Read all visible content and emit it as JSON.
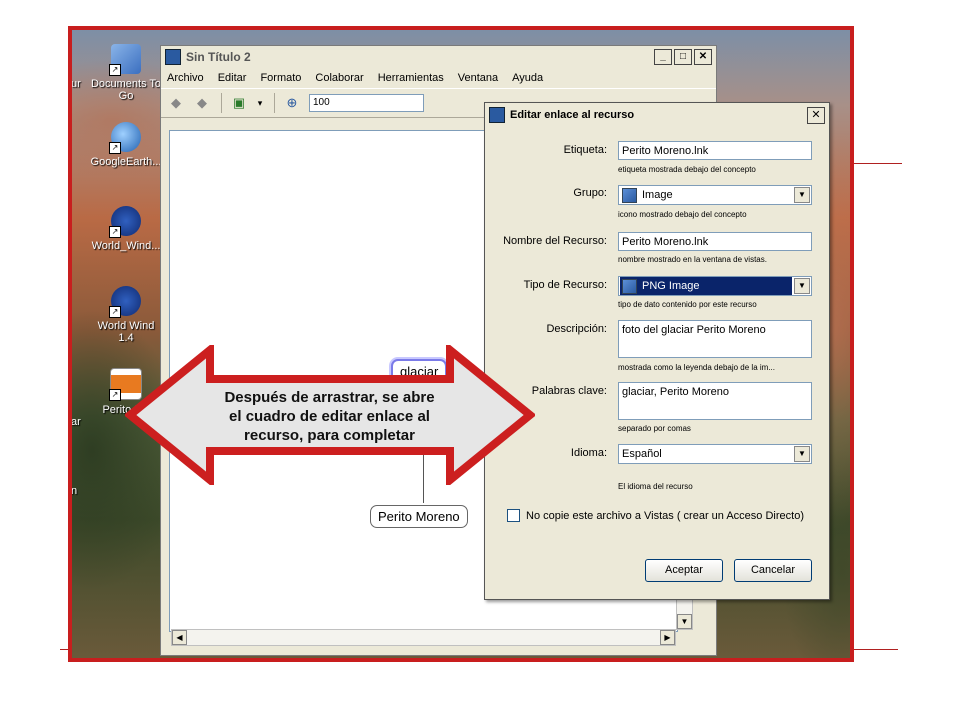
{
  "desktop": {
    "icons": [
      {
        "label": "Documents To Go",
        "icon": "documents-to-go-icon"
      },
      {
        "label": "GoogleEarth...",
        "icon": "google-earth-icon"
      },
      {
        "label": "World_Wind...",
        "icon": "nasa-icon"
      },
      {
        "label": "World Wind 1.4",
        "icon": "nasa-icon"
      },
      {
        "label": "Perito Mo",
        "icon": "image-file-icon"
      }
    ],
    "edge_texts": [
      "ur",
      "n",
      "ar"
    ]
  },
  "app": {
    "title": "Sin Título 2",
    "menu": [
      "Archivo",
      "Editar",
      "Formato",
      "Colaborar",
      "Herramientas",
      "Ventana",
      "Ayuda"
    ],
    "zoom": "100",
    "nodes": {
      "glaciar": "glaciar",
      "perito": "Perito Moreno"
    }
  },
  "dialog": {
    "title": "Editar enlace al recurso",
    "fields": {
      "etiqueta": {
        "label": "Etiqueta:",
        "value": "Perito Moreno.lnk",
        "help": "etiqueta mostrada debajo del concepto"
      },
      "grupo": {
        "label": "Grupo:",
        "value": "Image",
        "help": "icono mostrado debajo del concepto"
      },
      "nombre": {
        "label": "Nombre del Recurso:",
        "value": "Perito Moreno.lnk",
        "help": "nombre mostrado en la ventana de vistas."
      },
      "tipo": {
        "label": "Tipo de Recurso:",
        "value": "PNG Image",
        "help": "tipo de dato contenido por este recurso"
      },
      "descripcion": {
        "label": "Descripción:",
        "value": "foto del glaciar Perito Moreno",
        "help": "mostrada como la leyenda debajo de la im..."
      },
      "palabras": {
        "label": "Palabras clave:",
        "value": "glaciar, Perito Moreno",
        "help": "separado por comas"
      },
      "idioma": {
        "label": "Idioma:",
        "value": "Español",
        "help": "El idioma del recurso"
      }
    },
    "checkbox_label": "No copie este archivo a Vistas ( crear un Acceso Directo)",
    "accept": "Aceptar",
    "cancel": "Cancelar"
  },
  "callout": {
    "line1": "Después de arrastrar, se abre",
    "line2": "el cuadro de editar enlace al",
    "line3": "recurso, para completar"
  }
}
